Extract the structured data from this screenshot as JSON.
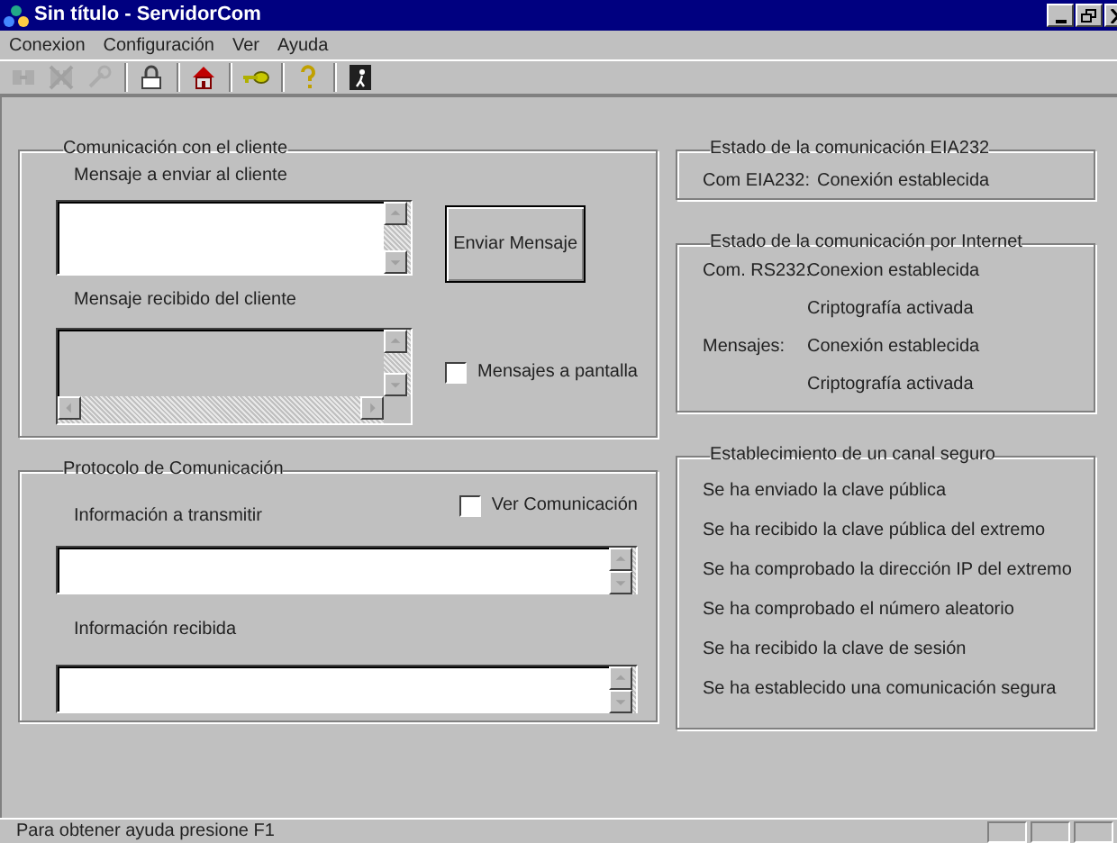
{
  "window": {
    "title": "Sin título - ServidorCom"
  },
  "menu": [
    {
      "label": "Conexion"
    },
    {
      "label": "Configuración"
    },
    {
      "label": "Ver"
    },
    {
      "label": "Ayuda"
    }
  ],
  "toolbar": [
    {
      "disabled": true
    },
    {
      "disabled": true
    },
    {
      "disabled": true
    },
    {
      "disabled": false
    },
    {
      "disabled": false
    },
    {
      "disabled": false
    },
    {
      "disabled": false
    },
    {
      "disabled": false
    }
  ],
  "client_group": {
    "title": "Comunicación con el cliente",
    "send_label": "Mensaje a enviar al cliente",
    "send_field": {
      "disabled": false
    },
    "send_button": "Enviar Mensaje",
    "received_label": "Mensaje recibido del cliente",
    "received_field": {
      "disabled": true
    },
    "screen_checkbox": {
      "label": "Mensajes a pantalla",
      "checked": false
    }
  },
  "protocol_group": {
    "title": "Protocolo de Comunicación",
    "view_checkbox": {
      "label": "Ver Comunicación",
      "checked": false
    },
    "transmit_label": "Información a transmitir",
    "received_label": "Información recibida"
  },
  "eia_group": {
    "title": "Estado de la comunicación EIA232",
    "rows": [
      {
        "label": "Com EIA232:",
        "value": "Conexión establecida"
      }
    ]
  },
  "internet_group": {
    "title": "Estado de la comunicación por Internet",
    "rows": [
      {
        "label": "Com. RS232:",
        "value": "Conexion establecida"
      },
      {
        "value": "Criptografía activada"
      },
      {
        "label": "Mensajes:",
        "value": "Conexión establecida"
      },
      {
        "value": "Criptografía activada"
      }
    ]
  },
  "secure_group": {
    "title": "Establecimiento de un canal seguro",
    "steps": [
      "Se ha enviado la clave pública",
      "Se ha recibido la clave pública del extremo",
      "Se ha comprobado la dirección IP del extremo",
      "Se ha comprobado el número aleatorio",
      "Se ha recibido la clave de sesión",
      "Se ha establecido una comunicación segura"
    ]
  },
  "status_bar": {
    "text": "Para obtener ayuda presione F1"
  }
}
